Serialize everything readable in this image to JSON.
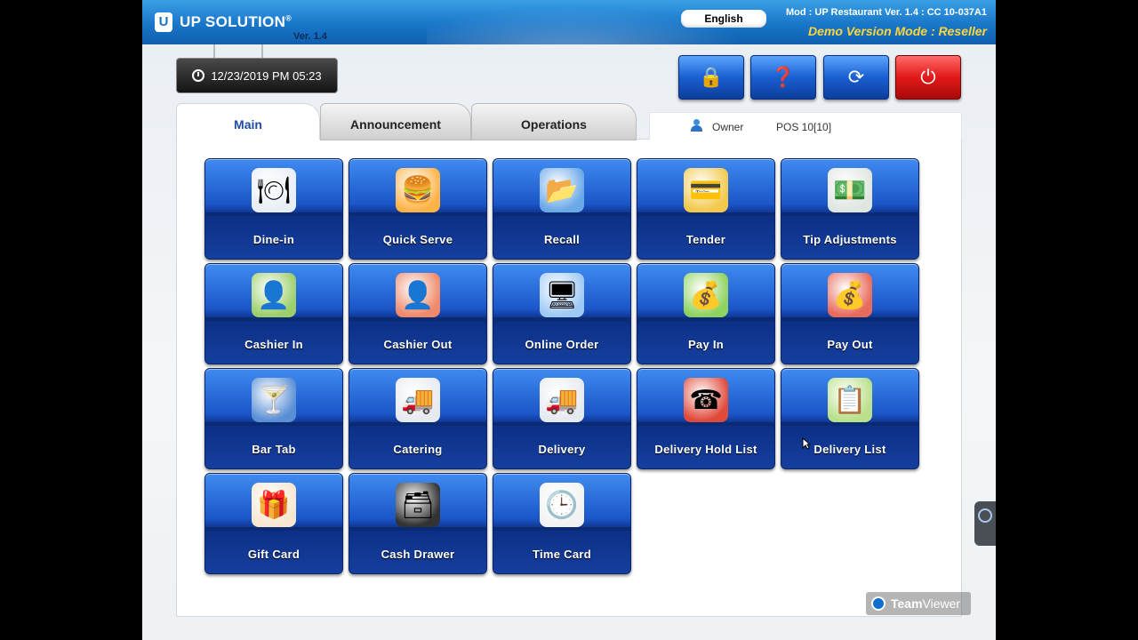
{
  "header": {
    "logo_mark": "U",
    "logo_text": "UP SOLUTION",
    "logo_reg": "®",
    "version": "Ver. 1.4",
    "language": "English",
    "mod_info": "Mod : UP Restaurant  Ver. 1.4 : CC 10-037A1",
    "demo_mode": "Demo Version Mode : Reseller"
  },
  "clock": {
    "datetime": "12/23/2019 PM 05:23"
  },
  "toolbar": {
    "buttons": [
      {
        "name": "lock",
        "glyph": "🔒"
      },
      {
        "name": "help",
        "glyph": "❓"
      },
      {
        "name": "sync",
        "glyph": "⟳"
      },
      {
        "name": "power",
        "glyph": "⏻"
      }
    ]
  },
  "tabs": {
    "main": "Main",
    "announcement": "Announcement",
    "operations": "Operations"
  },
  "status": {
    "user": "Owner",
    "pos": "POS 10[10]"
  },
  "tiles": [
    {
      "label": "Dine-in",
      "icon": "dine-in-icon",
      "glyph": "🍽",
      "color": "#e8eef5"
    },
    {
      "label": "Quick Serve",
      "icon": "quick-serve-icon",
      "glyph": "🍔",
      "color": "#ffb347"
    },
    {
      "label": "Recall",
      "icon": "recall-icon",
      "glyph": "📂",
      "color": "#6aa8e8"
    },
    {
      "label": "Tender",
      "icon": "tender-icon",
      "glyph": "💳",
      "color": "#f2c94c"
    },
    {
      "label": "Tip Adjustments",
      "icon": "tips-icon",
      "glyph": "💵",
      "color": "#dfe6e0"
    },
    {
      "label": "Cashier In",
      "icon": "cashier-in-icon",
      "glyph": "👤",
      "color": "#9ccf6b"
    },
    {
      "label": "Cashier Out",
      "icon": "cashier-out-icon",
      "glyph": "👤",
      "color": "#f08a6a"
    },
    {
      "label": "Online Order",
      "icon": "online-order-icon",
      "glyph": "🖥",
      "color": "#9ec9f5"
    },
    {
      "label": "Pay In",
      "icon": "pay-in-icon",
      "glyph": "💰",
      "color": "#8fd35f"
    },
    {
      "label": "Pay Out",
      "icon": "pay-out-icon",
      "glyph": "💰",
      "color": "#e86a5a"
    },
    {
      "label": "Bar Tab",
      "icon": "bar-tab-icon",
      "glyph": "🍸",
      "color": "#5a8fd6"
    },
    {
      "label": "Catering",
      "icon": "catering-icon",
      "glyph": "🚚",
      "color": "#e6eaef"
    },
    {
      "label": "Delivery",
      "icon": "delivery-icon",
      "glyph": "🚚",
      "color": "#e6eaef"
    },
    {
      "label": "Delivery Hold List",
      "icon": "delivery-hold-icon",
      "glyph": "☎",
      "color": "#e04a3a"
    },
    {
      "label": "Delivery List",
      "icon": "delivery-list-icon",
      "glyph": "📋",
      "color": "#b9e08a"
    },
    {
      "label": "Gift Card",
      "icon": "gift-card-icon",
      "glyph": "🎁",
      "color": "#f7e6d0"
    },
    {
      "label": "Cash Drawer",
      "icon": "cash-drawer-icon",
      "glyph": "🗃",
      "color": "#333333"
    },
    {
      "label": "Time Card",
      "icon": "time-card-icon",
      "glyph": "🕒",
      "color": "#f2f2f2"
    }
  ],
  "teamviewer": {
    "text_bold": "Team",
    "text": "Viewer"
  }
}
